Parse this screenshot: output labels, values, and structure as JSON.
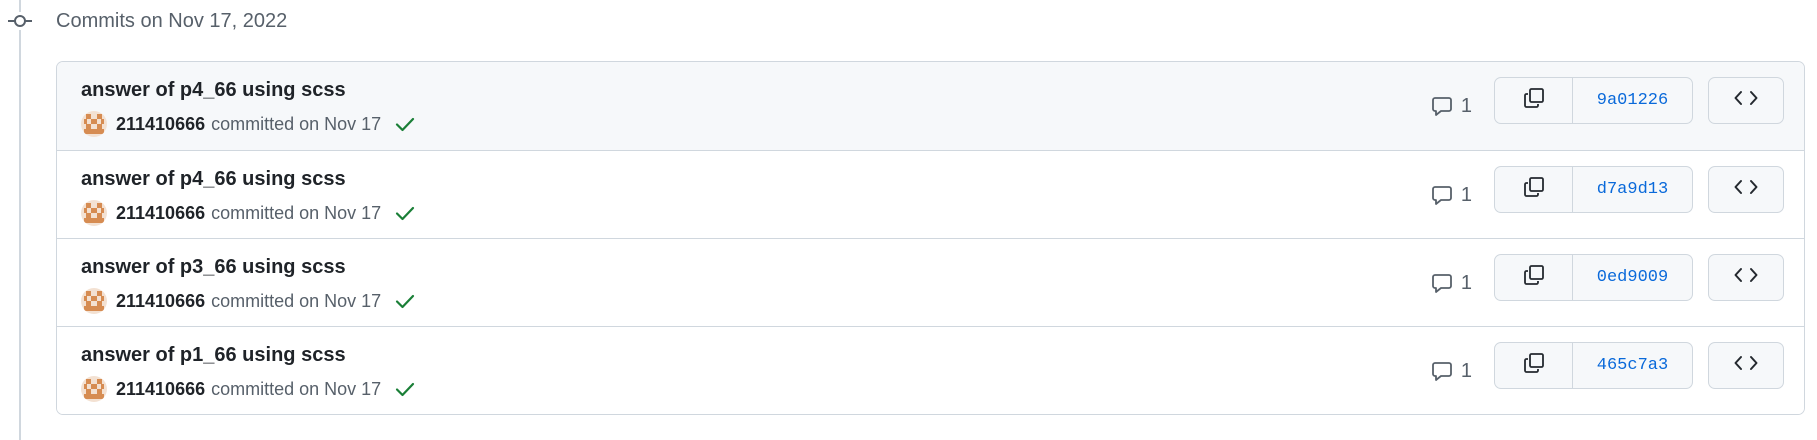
{
  "group": {
    "header": "Commits on Nov 17, 2022"
  },
  "commits": [
    {
      "title": "answer of p4_66 using scss",
      "author": "211410666",
      "committed_text": "committed on Nov 17",
      "status": "success",
      "comments": "1",
      "sha": "9a01226"
    },
    {
      "title": "answer of p4_66 using scss",
      "author": "211410666",
      "committed_text": "committed on Nov 17",
      "status": "success",
      "comments": "1",
      "sha": "d7a9d13"
    },
    {
      "title": "answer of p3_66 using scss",
      "author": "211410666",
      "committed_text": "committed on Nov 17",
      "status": "success",
      "comments": "1",
      "sha": "0ed9009"
    },
    {
      "title": "answer of p1_66 using scss",
      "author": "211410666",
      "committed_text": "committed on Nov 17",
      "status": "success",
      "comments": "1",
      "sha": "465c7a3"
    }
  ],
  "icons": {
    "timeline": "git-commit-icon",
    "avatar": "identicon-avatar",
    "status": "check-icon",
    "comment": "comment-icon",
    "copy": "copy-icon",
    "browse": "code-icon"
  },
  "colors": {
    "link": "#0969da",
    "success": "#1a7f37",
    "avatar": "#d68c52",
    "muted": "#57606a",
    "border": "#d0d7de",
    "button_bg": "#f6f8fa"
  }
}
